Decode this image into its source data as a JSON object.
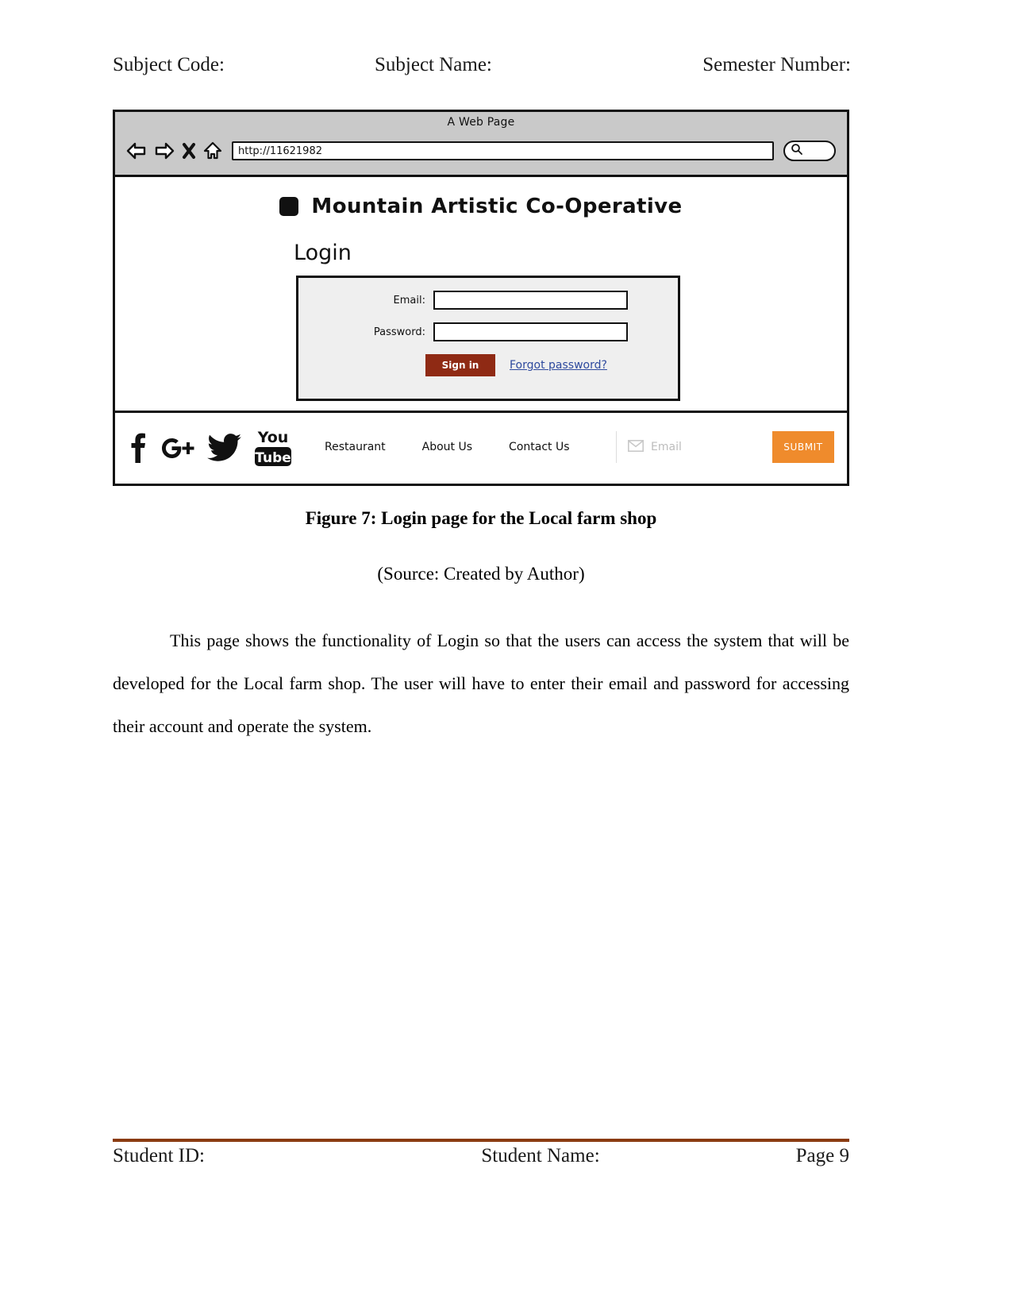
{
  "header": {
    "subject_code": "Subject Code:",
    "subject_name": "Subject Name:",
    "semester_number": "Semester Number:"
  },
  "wireframe": {
    "window_title": "A Web Page",
    "nav_icons": [
      "back-arrow-icon",
      "forward-arrow-icon",
      "close-x-icon",
      "home-icon"
    ],
    "address_bar": {
      "value": "http://11621982",
      "placeholder": "http://"
    },
    "search_pill": "search-icon",
    "brand": {
      "logo": "square-logo-icon",
      "name": "Mountain Artistic Co-Operative"
    },
    "page_heading": "Login",
    "form": {
      "email_label": "Email:",
      "email_value": "",
      "email_placeholder": "",
      "password_label": "Password:",
      "password_value": "",
      "password_placeholder": "",
      "signin_label": "Sign in",
      "forgot_label": "Forgot password?",
      "signin_color": "#8f2a14",
      "link_color": "#2e4a9e",
      "panel_color": "#efefef"
    },
    "footer": {
      "social": [
        {
          "name": "facebook-icon",
          "label": "f"
        },
        {
          "name": "google-plus-icon",
          "label": "G+"
        },
        {
          "name": "twitter-icon",
          "label": "twitter"
        },
        {
          "name": "youtube-icon",
          "label": "You Tube"
        }
      ],
      "links": [
        "Restaurant",
        "About Us",
        "Contact Us"
      ],
      "subscribe": {
        "icon": "envelope-icon",
        "placeholder": "Email",
        "value": "",
        "button_label": "SUBMIT",
        "button_color": "#ef8b2c"
      }
    }
  },
  "figure": {
    "caption": "Figure 7: Login page for the Local farm shop",
    "source": "(Source: Created by Author)"
  },
  "paragraph": "This page shows the functionality of Login so that the users can access the system that will be developed for the Local farm shop. The user will have to enter their email and password for accessing their account and operate the system.",
  "footer": {
    "student_id": "Student ID:",
    "student_name": "Student Name:",
    "page_label": "Page 9",
    "rule_color": "#8a3b10"
  }
}
